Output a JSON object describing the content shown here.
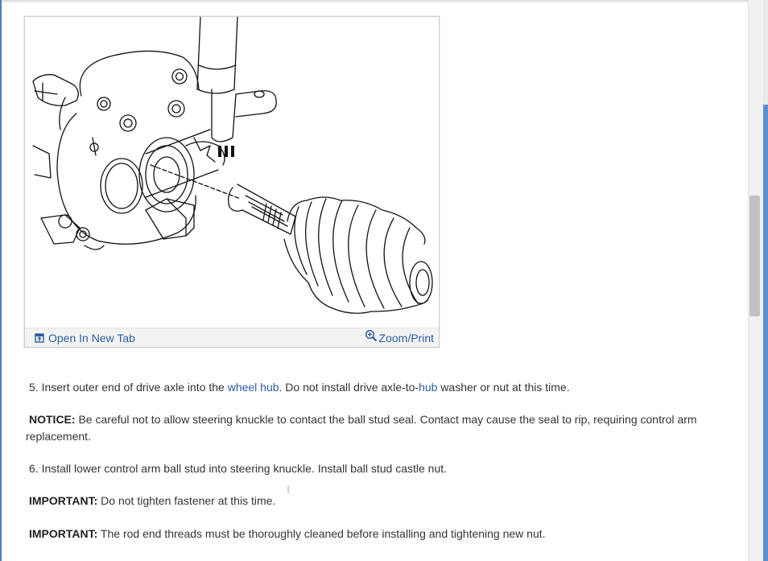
{
  "figure": {
    "open_new_tab_label": "Open In New Tab",
    "zoom_print_label": "Zoom/Print"
  },
  "steps": {
    "step5": {
      "prefix": "5. Insert outer end of drive axle into the ",
      "link1": "wheel hub",
      "middle": ". Do not install drive axle-to-",
      "link2": "hub",
      "suffix": " washer or nut at this time."
    },
    "notice": {
      "label": "NOTICE:",
      "text": " Be careful not to allow steering knuckle to contact the ball stud seal. Contact may cause the seal to rip, requiring control arm",
      "text2": "replacement."
    },
    "step6": {
      "text": "6. Install lower control arm ball stud into steering knuckle. Install ball stud castle nut."
    },
    "important1": {
      "label": "IMPORTANT:",
      "text": " Do not tighten fastener at this time."
    },
    "important2": {
      "label": "IMPORTANT:",
      "text": " The rod end threads must be thoroughly cleaned before installing and tightening new nut."
    }
  },
  "colors": {
    "link": "#2a5d9f",
    "text": "#333333",
    "accent_edge": "#4a7fc1"
  },
  "icons": {
    "open_tab": "open-in-new-tab-icon",
    "zoom": "zoom-in-icon"
  }
}
